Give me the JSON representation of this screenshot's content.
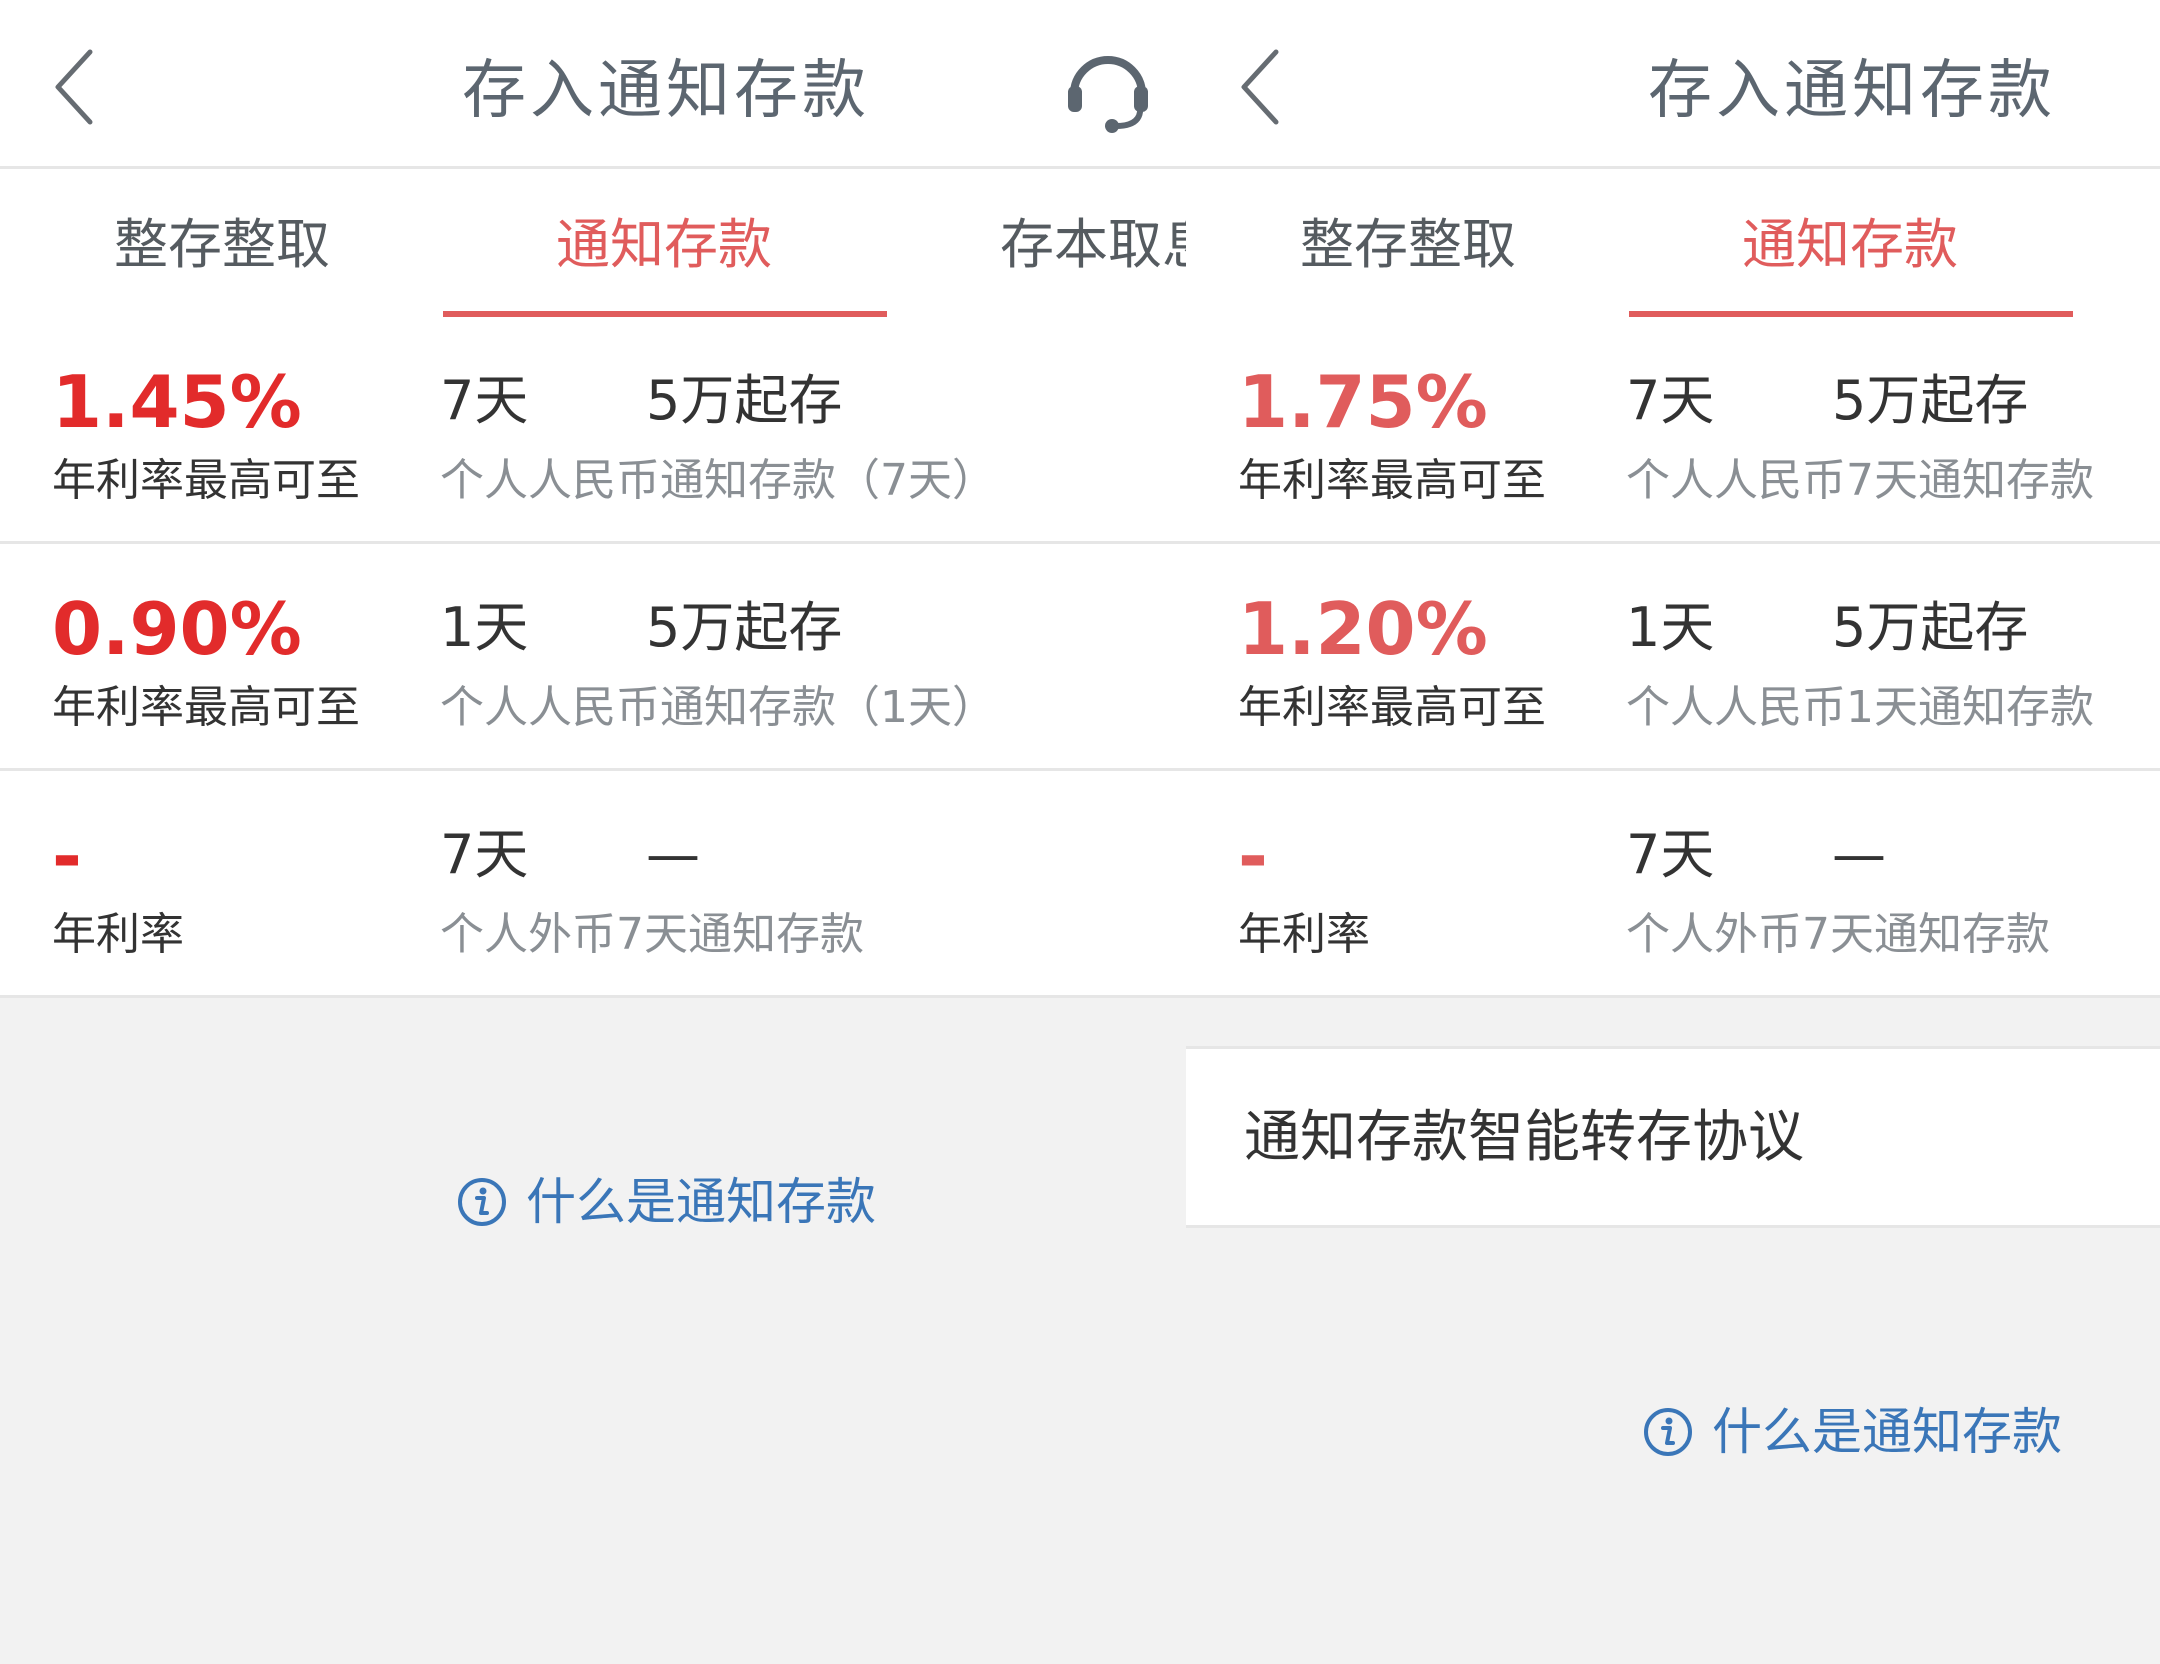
{
  "colors": {
    "accent_red": "#e05c5c",
    "rate_red": "#e22b2b",
    "link_blue": "#3a76b8",
    "title_gray": "#5c6670"
  },
  "screens": [
    {
      "title": "存入通知存款",
      "tabs": [
        {
          "label": "整存整取"
        },
        {
          "label": "通知存款"
        },
        {
          "label": "存本取息"
        }
      ],
      "rows": [
        {
          "rate": "1.45%",
          "rate_label": "年利率最高可至",
          "period": "7天",
          "min": "5万起存",
          "product": "个人人民币通知存款（7天）"
        },
        {
          "rate": "0.90%",
          "rate_label": "年利率最高可至",
          "period": "1天",
          "min": "5万起存",
          "product": "个人人民币通知存款（1天）"
        },
        {
          "rate": "-",
          "rate_label": "年利率",
          "period": "7天",
          "min": "—",
          "product": "个人外币7天通知存款"
        }
      ],
      "help_link": "什么是通知存款"
    },
    {
      "title": "存入通知存款",
      "tabs": [
        {
          "label": "整存整取"
        },
        {
          "label": "通知存款"
        }
      ],
      "rows": [
        {
          "rate": "1.75%",
          "rate_label": "年利率最高可至",
          "period": "7天",
          "min": "5万起存",
          "product": "个人人民币7天通知存款"
        },
        {
          "rate": "1.20%",
          "rate_label": "年利率最高可至",
          "period": "1天",
          "min": "5万起存",
          "product": "个人人民币1天通知存款"
        },
        {
          "rate": "-",
          "rate_label": "年利率",
          "period": "7天",
          "min": "—",
          "product": "个人外币7天通知存款"
        }
      ],
      "agreement": "通知存款智能转存协议",
      "help_link": "什么是通知存款"
    }
  ]
}
